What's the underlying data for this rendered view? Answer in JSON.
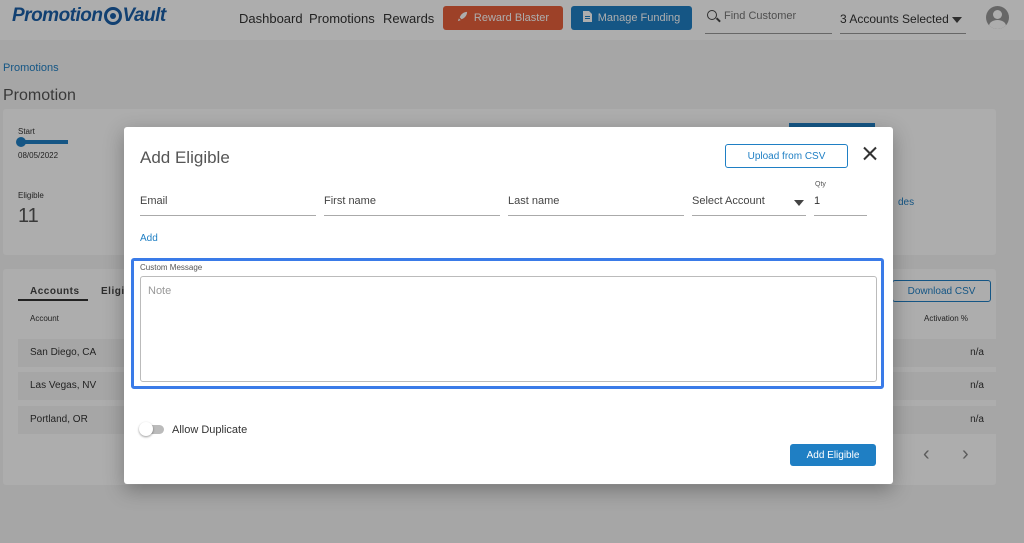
{
  "header": {
    "logo_text_1": "Promotion",
    "logo_text_2": "Vault",
    "nav": [
      "Dashboard",
      "Promotions",
      "Rewards"
    ],
    "reward_blaster_label": "Reward Blaster",
    "manage_funding_label": "Manage Funding",
    "search_placeholder": "Find Customer",
    "accounts_selected": "3 Accounts Selected"
  },
  "page": {
    "breadcrumb": "Promotions",
    "title": "Promotion",
    "start_label": "Start",
    "start_date": "08/05/2022",
    "eligible_label": "Eligible",
    "eligible_count": "11",
    "codes_fragment": "des",
    "tabs": [
      "Accounts",
      "Eligi"
    ],
    "download_csv_label": "Download CSV",
    "col_account": "Account",
    "col_activation": "Activation %",
    "rows": [
      {
        "account": "San Diego, CA",
        "activation": "n/a"
      },
      {
        "account": "Las Vegas, NV",
        "activation": "n/a"
      },
      {
        "account": "Portland, OR",
        "activation": "n/a"
      }
    ]
  },
  "modal": {
    "title": "Add Eligible",
    "upload_csv_label": "Upload from CSV",
    "email_placeholder": "Email",
    "first_name_placeholder": "First name",
    "last_name_placeholder": "Last name",
    "select_account_label": "Select Account",
    "qty_label": "Qty",
    "qty_value": "1",
    "add_link": "Add",
    "custom_message_label": "Custom Message",
    "note_placeholder": "Note",
    "allow_duplicate_label": "Allow Duplicate",
    "allow_duplicate_on": false,
    "add_eligible_button": "Add Eligible"
  },
  "colors": {
    "primary": "#1f7fc4",
    "reward": "#e8603c",
    "highlight": "#3a7be8"
  }
}
